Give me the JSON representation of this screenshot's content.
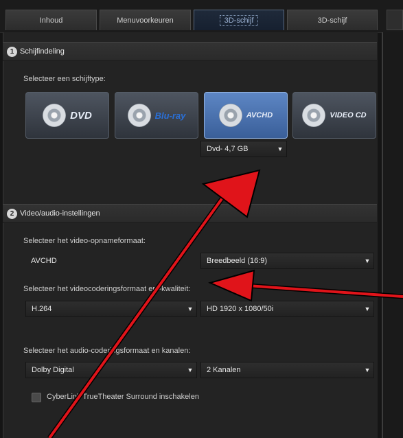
{
  "tabs": [
    {
      "label": "Inhoud"
    },
    {
      "label": "Menuvoorkeuren"
    },
    {
      "label": "3D-schijf"
    },
    {
      "label": "3D-schijf"
    }
  ],
  "section1": {
    "step": "1",
    "title": "Schijfindeling",
    "disc_label": "Selecteer een schijftype:"
  },
  "discs": [
    {
      "logo": "DVD",
      "icon": "dvd-disc-icon"
    },
    {
      "logo": "Blu-ray",
      "icon": "bluray-disc-icon"
    },
    {
      "logo": "AVCHD",
      "icon": "avchd-disc-icon"
    },
    {
      "logo": "VIDEO CD",
      "icon": "vcd-disc-icon"
    }
  ],
  "disc_size": {
    "value": "Dvd- 4,7 GB"
  },
  "section2": {
    "step": "2",
    "title": "Video/audio-instellingen",
    "record_label": "Selecteer het video-opnameformaat:",
    "record_format": "AVCHD",
    "aspect": "Breedbeeld (16:9)",
    "codec_label": "Selecteer het videocoderingsformaat en -kwaliteit:",
    "codec": "H.264",
    "quality": "HD 1920 x 1080/50i",
    "audio_label": "Selecteer het audio-coderingsformaat en kanalen:",
    "audio_codec": "Dolby Digital",
    "channels": "2 Kanalen",
    "surround_label": "CyberLink TrueTheater Surround inschakelen"
  },
  "colors": {
    "annotation_arrow": "#e0141a",
    "selected_disc": "#4a74b4"
  }
}
